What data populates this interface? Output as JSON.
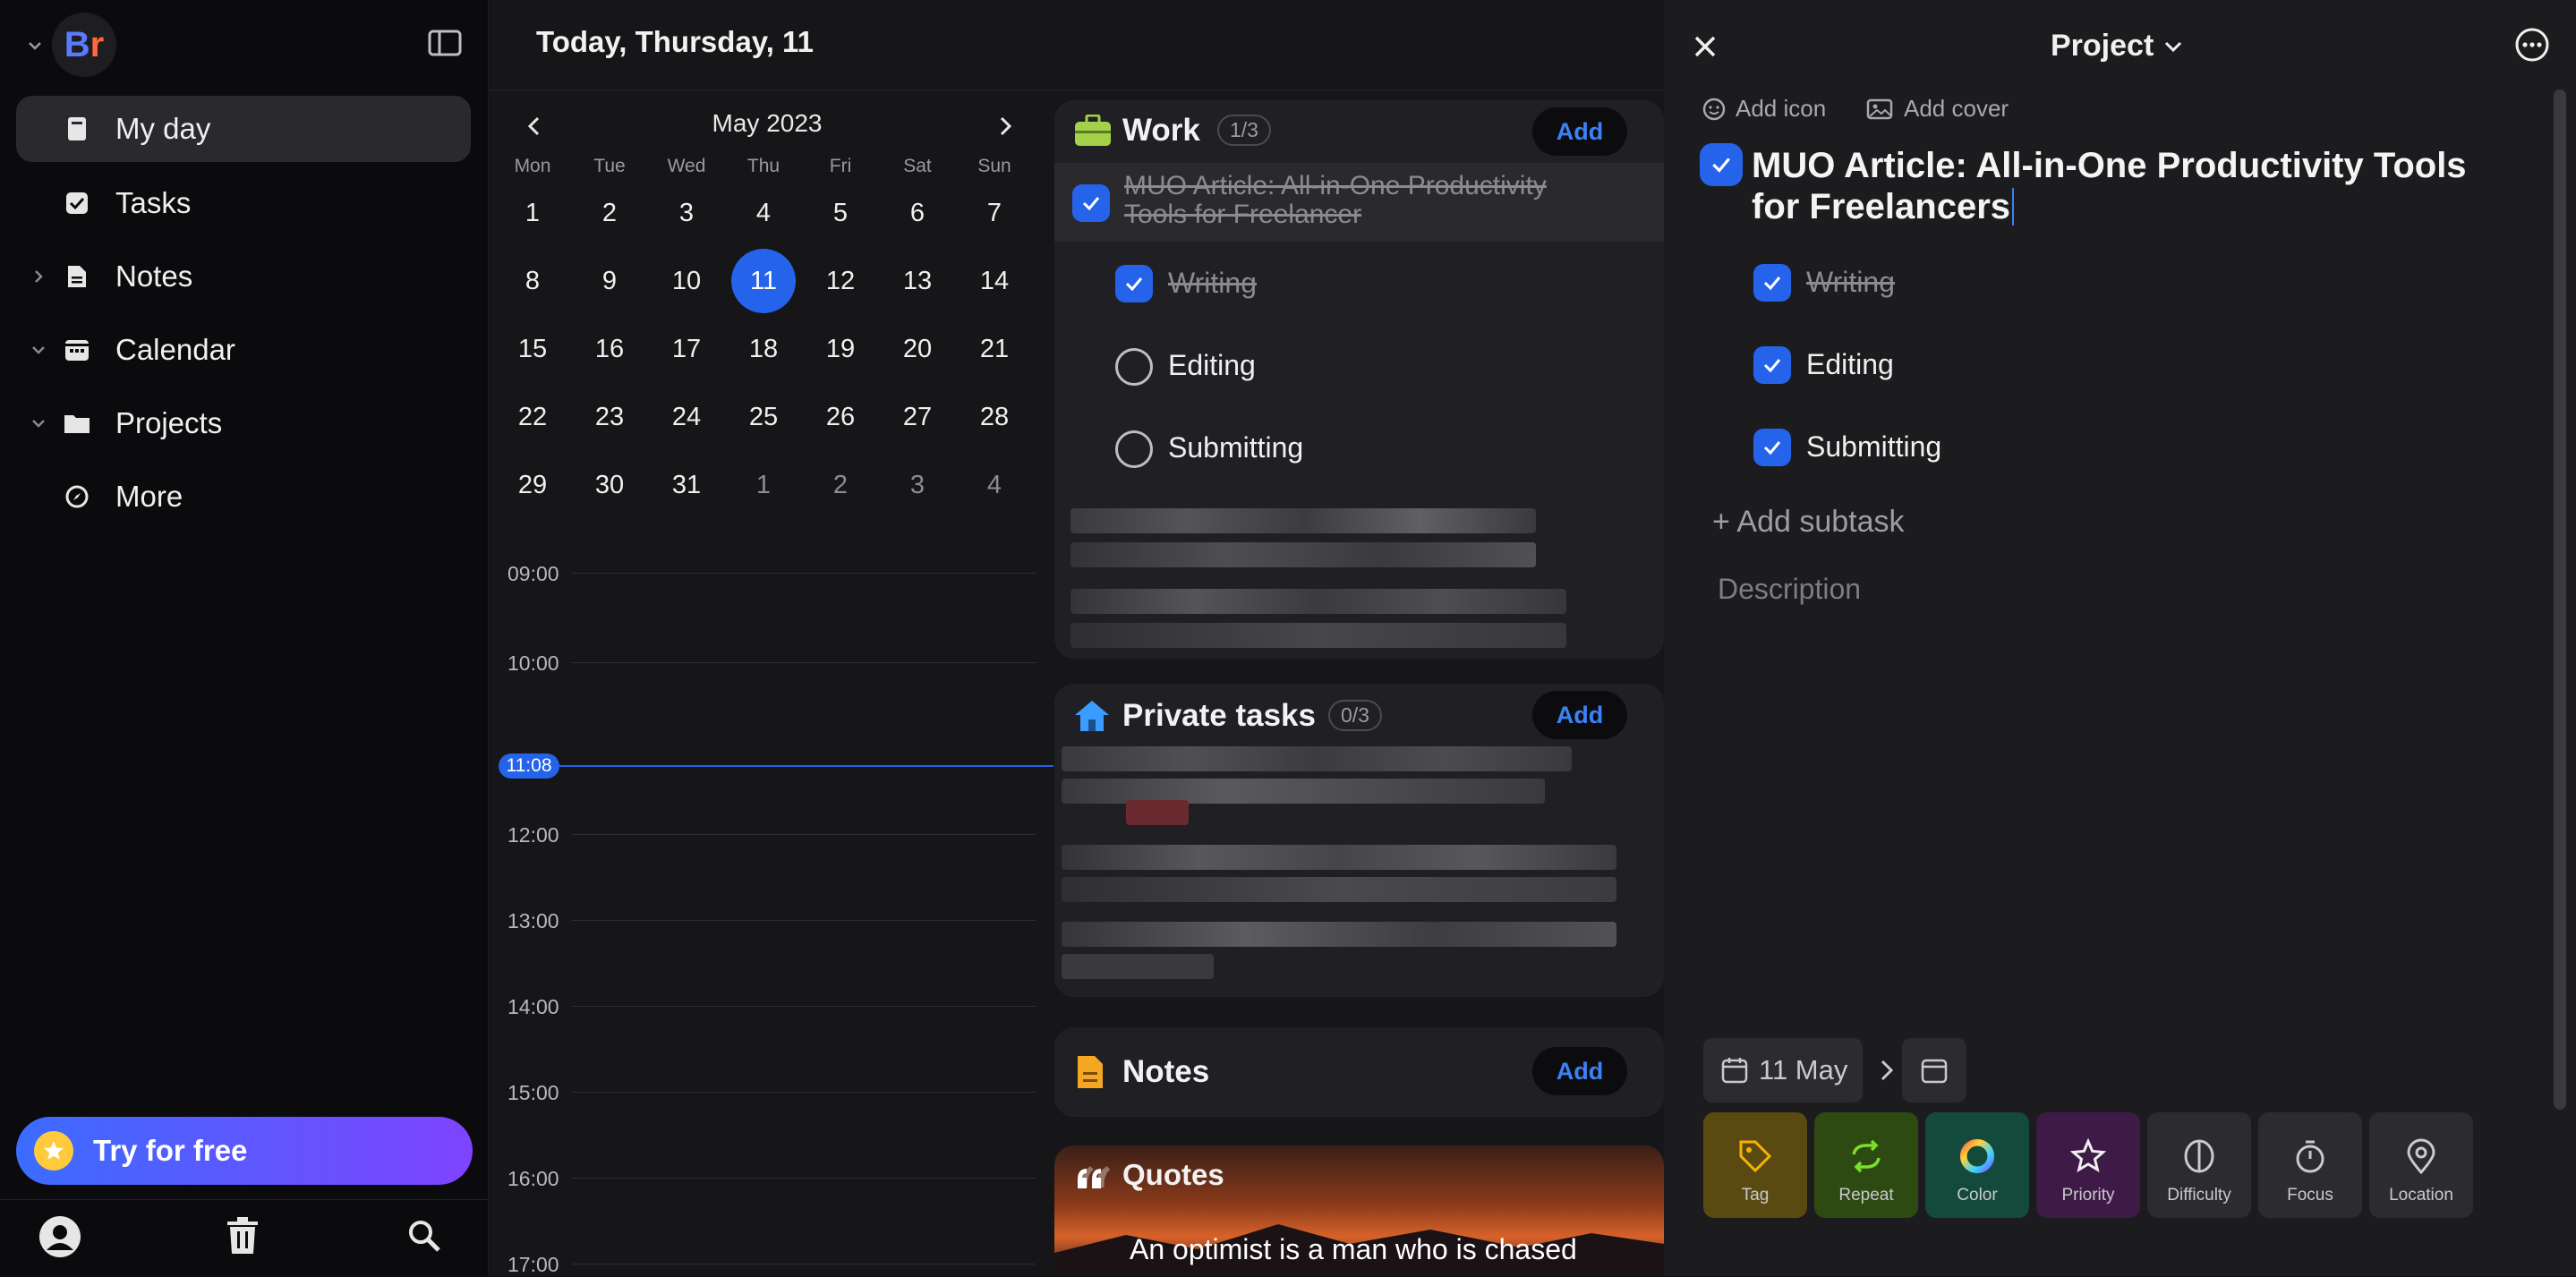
{
  "sidebar": {
    "logo": {
      "b": "B",
      "r": "r"
    },
    "items": [
      {
        "label": "My day"
      },
      {
        "label": "Tasks"
      },
      {
        "label": "Notes"
      },
      {
        "label": "Calendar"
      },
      {
        "label": "Projects"
      },
      {
        "label": "More"
      }
    ],
    "try_label": "Try for free"
  },
  "header": {
    "title": "Today, Thursday, 11"
  },
  "calendar": {
    "month": "May 2023",
    "weekdays": [
      "Mon",
      "Tue",
      "Wed",
      "Thu",
      "Fri",
      "Sat",
      "Sun"
    ],
    "weeks": [
      [
        "1",
        "2",
        "3",
        "4",
        "5",
        "6",
        "7"
      ],
      [
        "8",
        "9",
        "10",
        "11",
        "12",
        "13",
        "14"
      ],
      [
        "15",
        "16",
        "17",
        "18",
        "19",
        "20",
        "21"
      ],
      [
        "22",
        "23",
        "24",
        "25",
        "26",
        "27",
        "28"
      ],
      [
        "29",
        "30",
        "31",
        "1",
        "2",
        "3",
        "4"
      ]
    ],
    "selected_day": "11"
  },
  "timeline": {
    "times": [
      "09:00",
      "10:00",
      "11:08",
      "12:00",
      "13:00",
      "14:00",
      "15:00",
      "16:00",
      "17:00"
    ],
    "current": "11:08"
  },
  "work": {
    "title": "Work",
    "count": "1/3",
    "add": "Add",
    "task": {
      "line1": "MUO Article: All-in-One Productivity",
      "line2": "Tools for Freelancer"
    },
    "subtasks": [
      "Writing",
      "Editing",
      "Submitting"
    ]
  },
  "private": {
    "title": "Private tasks",
    "count": "0/3",
    "add": "Add"
  },
  "notes": {
    "title": "Notes",
    "add": "Add"
  },
  "quotes": {
    "title": "Quotes",
    "text": "An optimist is a man who is chased"
  },
  "panel": {
    "project_label": "Project",
    "add_icon": "Add icon",
    "add_cover": "Add cover",
    "title_line1": "MUO Article: All-in-One Productivity Tools",
    "title_line2": "for Freelancers",
    "subtasks": [
      "Writing",
      "Editing",
      "Submitting"
    ],
    "add_subtask": "+ Add subtask",
    "description_placeholder": "Description",
    "date": "11 May",
    "chips": [
      "Tag",
      "Repeat",
      "Color",
      "Priority",
      "Difficulty",
      "Focus",
      "Location"
    ]
  },
  "colors": {
    "accent": "#2563eb",
    "tag": "#5a4a12",
    "repeat": "#2c4a12",
    "color": "#134a3b",
    "priority": "#3e1a47",
    "neutral": "#2c2c30"
  }
}
